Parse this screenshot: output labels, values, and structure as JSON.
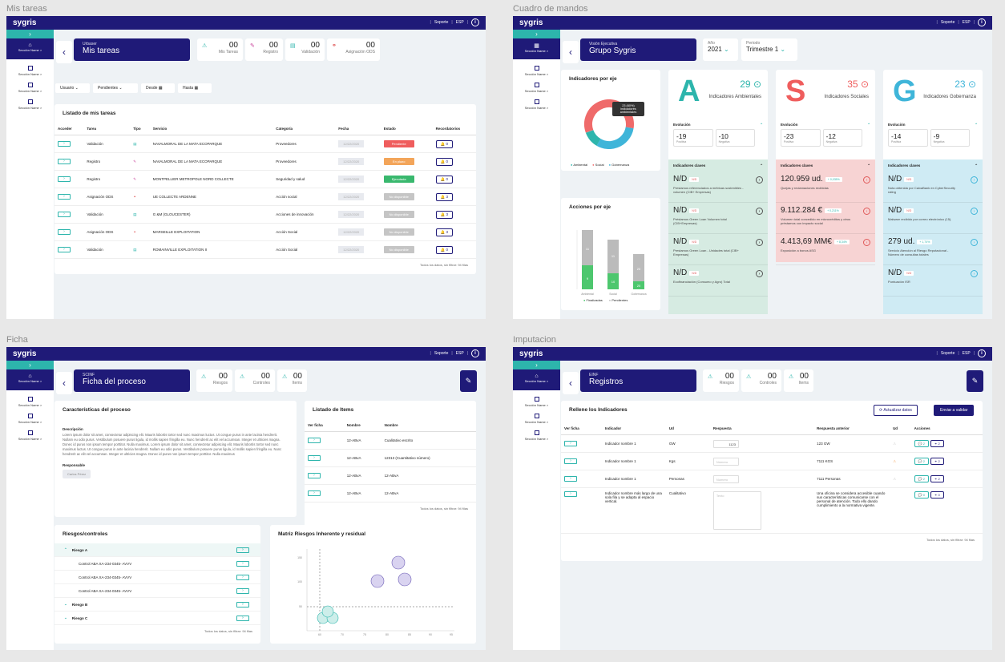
{
  "frames": {
    "f1": "Mis tareas",
    "f2": "Cuadro de mandos",
    "f3": "Ficha",
    "f4": "Imputacion"
  },
  "app": {
    "logo": "sygris",
    "support": "Soporte",
    "lang": "ESP",
    "info": "i",
    "section": "Sección Name >"
  },
  "tasks": {
    "title_sub": "Urbaser",
    "title": "Mis tareas",
    "counters": [
      {
        "value": "00",
        "label": "Mis Tareas"
      },
      {
        "value": "00",
        "label": "Registro"
      },
      {
        "value": "00",
        "label": "Validación"
      },
      {
        "value": "00",
        "label": "Asignación ODS"
      }
    ],
    "filters": [
      "Usuario",
      "Pendientes",
      "Desde",
      "Hasta"
    ],
    "card_title": "Listado de mis tareas",
    "columns": [
      "Acceder",
      "Tarea",
      "Tipo",
      "Servicio",
      "Categoría",
      "Fecha",
      "Estado",
      "Recordatorios"
    ],
    "rows": [
      {
        "tarea": "Validación",
        "servicio": "NAVALMORAL DE LA MATA ECOPARQUE",
        "categoria": "Proveedores",
        "fecha": "12/22/2020",
        "estado": "Pendiente",
        "rec": "0"
      },
      {
        "tarea": "Registro",
        "servicio": "NAVALMORAL DE LA MATA ECOPARQUE",
        "categoria": "Proveedores",
        "fecha": "12/22/2020",
        "estado": "En plazo",
        "rec": "0"
      },
      {
        "tarea": "Registro",
        "servicio": "MONTPELLIER METROPOLE NORD COLLECTE",
        "categoria": "Seguridad y salud",
        "fecha": "12/22/2020",
        "estado": "Ejecutada",
        "rec": "0"
      },
      {
        "tarea": "Asignación ODS",
        "servicio": "UE COLLECTE ARDENNE",
        "categoria": "Acción social",
        "fecha": "12/22/2020",
        "estado": "No disponible",
        "rec": "3"
      },
      {
        "tarea": "Validación",
        "servicio": "G &M (GLOUCESTER)",
        "categoria": "Acciones de innovación",
        "fecha": "12/22/2020",
        "estado": "No disponible",
        "rec": "3"
      },
      {
        "tarea": "Asignación ODS",
        "servicio": "MARSEILLE EXPLOITATION",
        "categoria": "Acción Social",
        "fecha": "12/22/2020",
        "estado": "No disponible",
        "rec": "3"
      },
      {
        "tarea": "Validación",
        "servicio": "ROMAINVILLE EXPLOITATION II",
        "categoria": "Acción Social",
        "fecha": "12/22/2020",
        "estado": "No disponible",
        "rec": "0"
      }
    ],
    "footer": "Todos los datos, sin filtrar: 94 filas"
  },
  "dash": {
    "title_sub": "Visión Ejecutiva",
    "title": "Grupo Sygris",
    "year_label": "Año",
    "year": "2021",
    "period_label": "Periodo",
    "period": "Trimestre 1",
    "donut_title": "Indicadores por eje",
    "tooltip": "23 (60%) indicadores ambientales",
    "legend": [
      "Ambiental",
      "Social",
      "Gobernanza"
    ],
    "bars_title": "Acciones por eje",
    "legend2": [
      "Finalizadas",
      "Pendientes"
    ],
    "cards": [
      {
        "letter": "A",
        "num": "29",
        "label": "Indicadores Ambientales",
        "e1": "19",
        "e1l": "Positiva",
        "e2": "10",
        "e2l": "Negativa",
        "items": [
          {
            "v": "N/D",
            "tag": "N/D",
            "d": "Prestamos referenciados a métricas sostenibles - volumen (CIB+ Empresas)"
          },
          {
            "v": "N/D",
            "tag": "N/D",
            "d": "Préstamos Green Loan Volumen total (CIB+Empresas)"
          },
          {
            "v": "N/D",
            "tag": "N/D",
            "d": "Prestamos Green Loan - Unidades total (CIB+ Empresas)"
          },
          {
            "v": "N/D",
            "tag": "N/D",
            "d": "Ecofinanciación (Consumo y Agro) Total"
          }
        ]
      },
      {
        "letter": "S",
        "num": "35",
        "label": "Indicadores Sociales",
        "e1": "23",
        "e1l": "Positiva",
        "e2": "12",
        "e2l": "Negativa",
        "items": [
          {
            "v": "120.959 ud.",
            "tag": "+ 0,035%",
            "d": "Quejas y reclamaciones recibidas"
          },
          {
            "v": "9.112.284 €",
            "tag": "+ 0,211%",
            "d": "Volumen total concedido en microcréditos y otros préstamos con impacto social"
          },
          {
            "v": "4.413,69 MM€",
            "tag": "+ 8,34%",
            "d": "Exposición a bonos ASG"
          }
        ]
      },
      {
        "letter": "G",
        "num": "23",
        "label": "Indicadores Gobernanza",
        "e1": "14",
        "e1l": "Positiva",
        "e2": "9",
        "e2l": "Negativa",
        "items": [
          {
            "v": "N/D",
            "tag": "N/D",
            "d": "Nota obtenida por CaixaBank en CyberSecurity rating"
          },
          {
            "v": "N/D",
            "tag": "N/D",
            "d": "Malware recibido por correo electrónico (15)."
          },
          {
            "v": "279 ud.",
            "tag": "+ 1,74%",
            "d": "Servicio Atención al Riesgo Reputacional - Número de consultas totales"
          },
          {
            "v": "N/D",
            "tag": "N/D",
            "d": "Puntuación ISR"
          }
        ]
      }
    ],
    "evol_label": "Evolución",
    "kk_label": "Indicadores claves"
  },
  "ficha": {
    "title_sub": "SCINF",
    "title": "Ficha del proceso",
    "counters": [
      {
        "value": "00",
        "label": "Riesgos"
      },
      {
        "value": "00",
        "label": "Controles"
      },
      {
        "value": "00",
        "label": "Items"
      }
    ],
    "char_title": "Características del proceso",
    "desc_label": "Descripción",
    "desc": "Lorem ipsum dolor sit amet, consectetur adipiscing elit. Mauris lobortis tortor sed nunc maximus luctus. Ut congue purus in ante lacinia hendrerit. Nullam eu odio purus. Vestibulum posuere purus ligula, id mollis sapien fringilla eu. Nunc hendrerit ac elit vel accumsan. Integer et ultricies magna. Donec id purus non ipsum tempor porttitor. Nulla maximus. Lorem ipsum dolor sit amet, consectetur adipiscing elit. Mauris lobortis tortor sed nunc maximus luctus. Ut congue purus in ante lacinia hendrerit. Nullam eu odio purus. Vestibulum posuere purus ligula, id mollis sapien fringilla eu. Nunc hendrerit ac elit vel accumsan. Integer et ultricies magna. Donec id purus non ipsum tempor porttitor. Nulla maximus",
    "resp_label": "Responsable",
    "resp": "Carlos Pérez",
    "items_title": "Listado de Items",
    "items_cols": [
      "Ver ficha",
      "Nombre",
      "Nombre"
    ],
    "items": [
      {
        "a": "12-ABvA",
        "b": "Cualitativo escrito"
      },
      {
        "a": "12-ABvA",
        "b": "12313 (Cuantitativo número)"
      },
      {
        "a": "12-ABvA",
        "b": "12-ABvA"
      },
      {
        "a": "12-ABvA",
        "b": "12-ABvA"
      }
    ],
    "items_footer": "Todos los datos, sin filtrar: 94 filas",
    "risk_title": "Riesgos/controles",
    "risks": [
      "Riesgo A",
      "Control ABA XA-234-0345- AVVV",
      "Control ABA XA-234-0345- AVVV",
      "Control ABA XA-234-0345- AVVV",
      "Riesgo B",
      "Riesgo C"
    ],
    "risk_footer": "Todos los datos, sin filtrar: 94 filas",
    "matrix_title": "Matriz Riesgos Inherente y residual"
  },
  "imput": {
    "title_sub": "EINF",
    "title": "Registros",
    "counters": [
      {
        "value": "00",
        "label": "Riesgos"
      },
      {
        "value": "00",
        "label": "Controles"
      },
      {
        "value": "00",
        "label": "Items"
      }
    ],
    "card_title": "Rellene los Indicadores",
    "refresh": "Actualizar datos",
    "send": "Enviar a validar",
    "cols": [
      "Ver ficha",
      "Indicador",
      "Ud",
      "Respuesta",
      "Respuesta anterior",
      "Ud",
      "Acciones"
    ],
    "rows": [
      {
        "ind": "Indicador nombre 1",
        "ud": "GW",
        "resp": "1123",
        "prev": "123 GW",
        "c1": "2",
        "c2": "2"
      },
      {
        "ind": "Indicador nombre 1",
        "ud": "Kgs",
        "resp": "Número",
        "prev": "7111 KGS",
        "c1": "2",
        "c2": "2"
      },
      {
        "ind": "Indicador nombre 1",
        "ud": "Personas",
        "resp": "Número",
        "prev": "7111 Personas",
        "c1": "2",
        "c2": "2"
      },
      {
        "ind": "Indicador nombre más largo de una sola fila y se adapta al espacio vertical.",
        "ud": "Cualitativo",
        "resp": "Texto",
        "prev": "Una oficina se considera accesible cuando sus características comunicarse con el personal de atención. Todo ello dando cumplimiento a la normativa vigente.",
        "c1": "0",
        "c2": "0"
      }
    ],
    "footer": "Todos los datos, sin filtrar: 94 filas"
  }
}
